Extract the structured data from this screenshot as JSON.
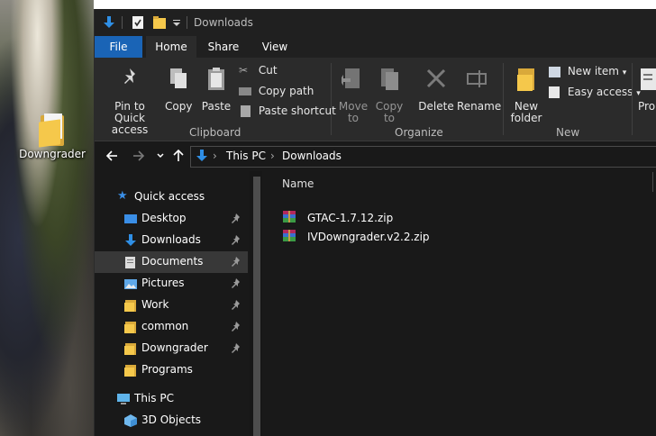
{
  "desktop": {
    "icon_label": "Downgrader"
  },
  "window": {
    "title": "Downloads"
  },
  "tabs": [
    "File",
    "Home",
    "Share",
    "View"
  ],
  "ribbon": {
    "pin_to_quick_access": "Pin to Quick access",
    "copy": "Copy",
    "paste": "Paste",
    "cut": "Cut",
    "copy_path": "Copy path",
    "paste_shortcut": "Paste shortcut",
    "move_to": "Move to",
    "copy_to": "Copy to",
    "delete": "Delete",
    "rename": "Rename",
    "new_folder": "New folder",
    "new_item": "New item",
    "easy_access": "Easy access",
    "properties_partial": "Prop",
    "groups": {
      "clipboard": "Clipboard",
      "organize": "Organize",
      "new": "New"
    }
  },
  "address": {
    "segments": [
      "This PC",
      "Downloads"
    ]
  },
  "navigation": {
    "quick_access": "Quick access",
    "items": [
      {
        "label": "Desktop",
        "icon": "desktop-icon",
        "pinned": true
      },
      {
        "label": "Downloads",
        "icon": "download-arrow-icon",
        "pinned": true
      },
      {
        "label": "Documents",
        "icon": "documents-icon",
        "pinned": true,
        "selected": true
      },
      {
        "label": "Pictures",
        "icon": "pictures-icon",
        "pinned": true
      },
      {
        "label": "Work",
        "icon": "folder-icon",
        "pinned": true
      },
      {
        "label": "common",
        "icon": "folder-icon",
        "pinned": true
      },
      {
        "label": "Downgrader",
        "icon": "folder-icon",
        "pinned": true
      },
      {
        "label": "Programs",
        "icon": "folder-icon",
        "pinned": false
      }
    ],
    "this_pc": "This PC",
    "objects_3d": "3D Objects"
  },
  "files": {
    "column_name": "Name",
    "items": [
      {
        "name": "GTAC-1.7.12.zip",
        "icon": "winrar-archive-icon"
      },
      {
        "name": "IVDowngrader.v2.2.zip",
        "icon": "winrar-archive-icon"
      }
    ]
  },
  "colors": {
    "accent": "#1a64b6",
    "window_bg": "#191919",
    "ribbon_bg": "#2b2b2b",
    "folder": "#f5c84b"
  }
}
